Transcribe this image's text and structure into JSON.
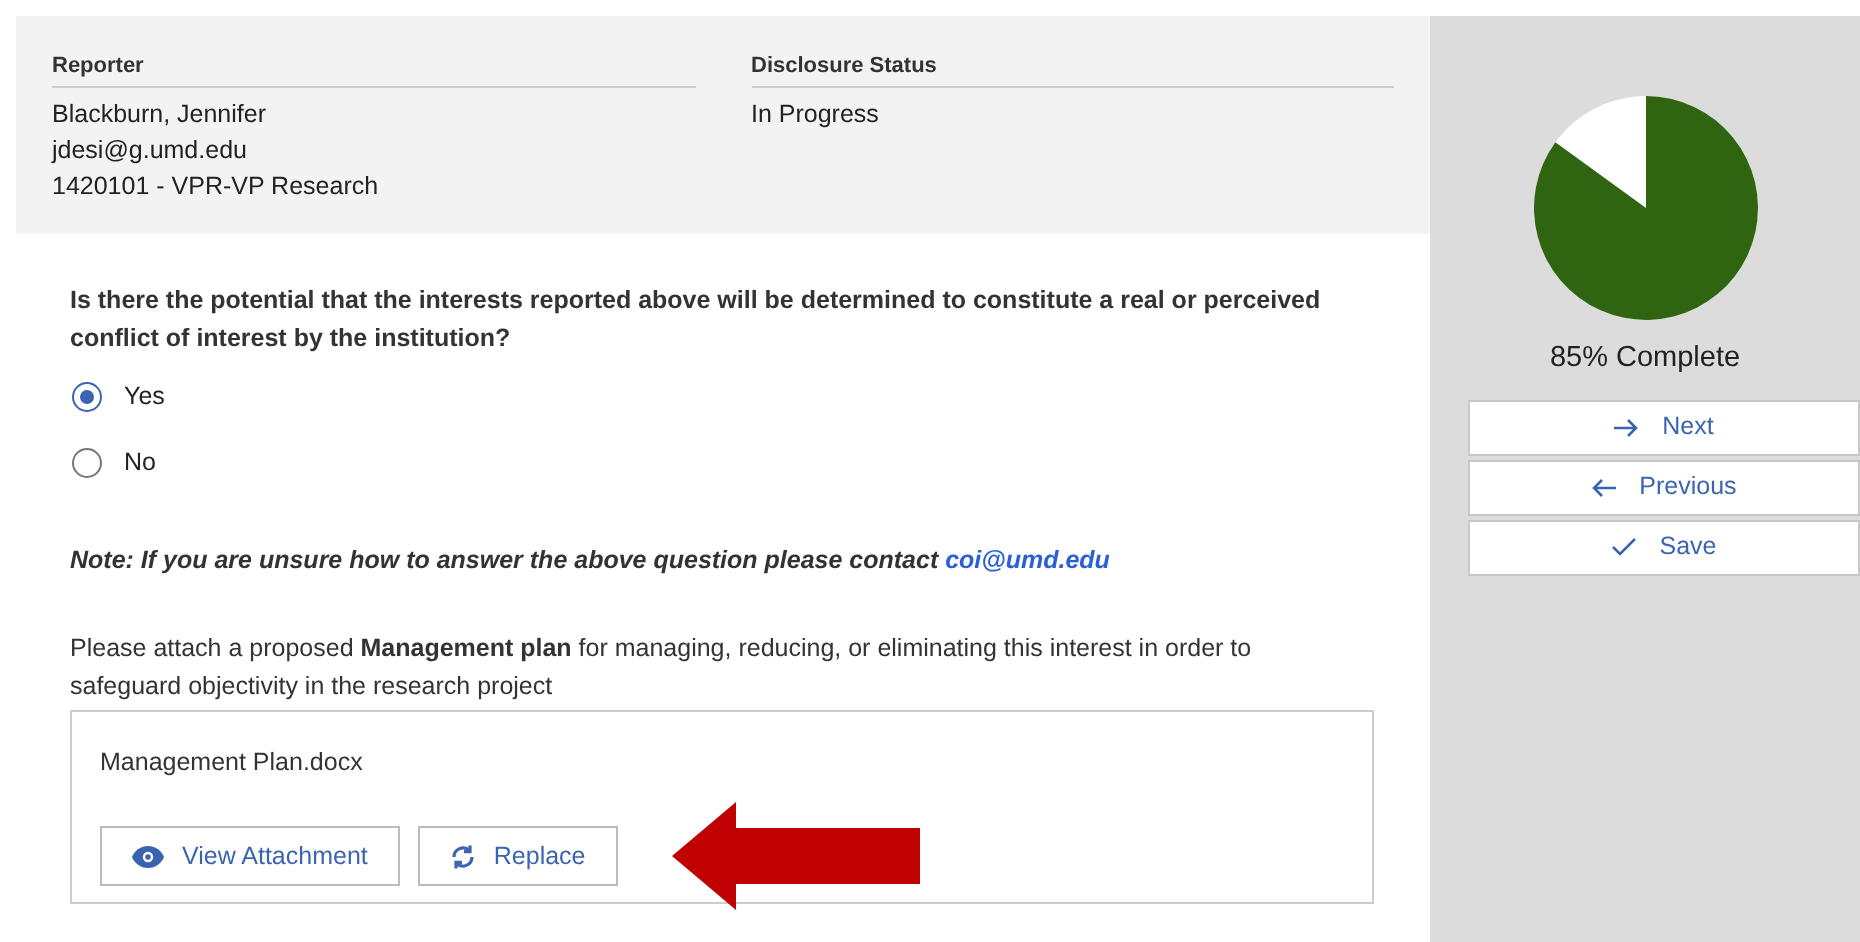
{
  "header": {
    "fields": [
      {
        "label": "Reporter",
        "lines": [
          "Blackburn, Jennifer",
          "jdesi@g.umd.edu",
          "1420101 - VPR-VP Research"
        ]
      },
      {
        "label": "Disclosure Status",
        "lines": [
          "In Progress"
        ]
      }
    ]
  },
  "question": {
    "text": "Is there the potential that the interests reported above will be determined to constitute a real or perceived conflict of interest by the institution?",
    "options": [
      {
        "label": "Yes",
        "selected": true
      },
      {
        "label": "No",
        "selected": false
      }
    ]
  },
  "note": {
    "text": "Note: If you are unsure how to answer the above question please contact",
    "link": "coi@umd.edu"
  },
  "attachment": {
    "prompt": "Please attach a proposed **Management plan** for managing, reducing, or eliminating this interest in order to safeguard objectivity in the research project",
    "file_name": "Management Plan.docx",
    "buttons": [
      {
        "kind": "view",
        "label": "View Attachment"
      },
      {
        "kind": "replace",
        "label": "Replace"
      }
    ]
  },
  "progress": {
    "label": "85% Complete"
  },
  "nav_buttons": [
    {
      "kind": "next",
      "label": "Next"
    },
    {
      "kind": "previous",
      "label": "Previous"
    },
    {
      "kind": "save",
      "label": "Save"
    }
  ]
}
